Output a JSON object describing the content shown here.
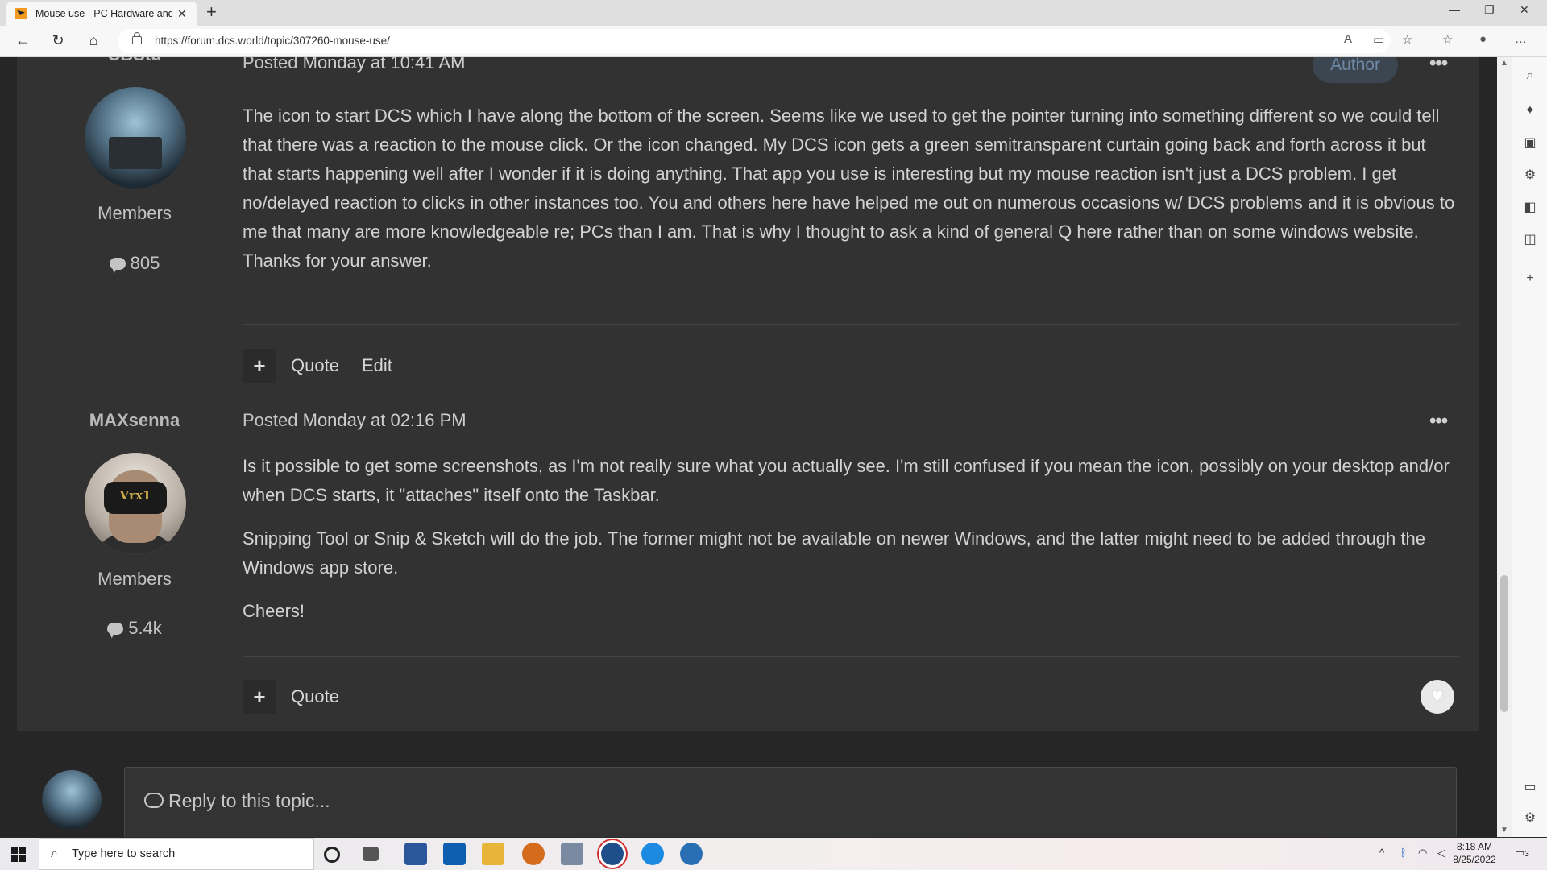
{
  "browser": {
    "tab_title": "Mouse use - PC Hardware and R",
    "tab_close": "✕",
    "new_tab": "+",
    "url": "https://forum.dcs.world/topic/307260-mouse-use/",
    "window_minimize": "—",
    "window_restore": "❐",
    "window_close": "✕"
  },
  "posts": [
    {
      "author": "CBStu",
      "posted_label": "Posted",
      "posted_time": "Monday at 10:41 AM",
      "badge": "Author",
      "group": "Members",
      "count": "805",
      "paragraphs": [
        "The icon to start DCS which I have along the bottom of the screen. Seems like we used to get the pointer turning into something different so we could tell that there was a reaction to the mouse click. Or the icon changed. My DCS icon gets a green semitransparent curtain going back and forth across it but that starts happening well after I wonder if it is doing anything. That app you use is interesting but my mouse reaction isn't just a DCS problem. I get no/delayed reaction to clicks in other instances too. You and others here have helped me out on numerous occasions w/ DCS problems and it is obvious to me that many are more knowledgeable re; PCs  than I am. That is why I thought to ask a kind of general Q here rather than on some windows website. Thanks for your answer."
      ],
      "actions": [
        "Quote",
        "Edit"
      ]
    },
    {
      "author": "MAXsenna",
      "posted_label": "Posted",
      "posted_time": "Monday at 02:16 PM",
      "group": "Members",
      "count": "5.4k",
      "avatar_text": "Vrx1",
      "paragraphs": [
        "Is it possible to get some screenshots, as I'm not really sure what you actually see. I'm still confused if you mean the icon, possibly on your desktop and/or when DCS starts, it \"attaches\" itself onto the Taskbar.",
        "Snipping Tool or Snip & Sketch will do the job. The former might not be available on newer Windows, and the latter might need to be added through the Windows app store.",
        "Cheers!"
      ],
      "actions": [
        "Quote"
      ]
    }
  ],
  "menu_dots": "•••",
  "plus_label": "+",
  "reply": {
    "placeholder": "Reply to this topic..."
  },
  "taskbar": {
    "search_placeholder": "Type here to search",
    "time": "8:18 AM",
    "date": "8/25/2022",
    "notifications": "3"
  },
  "colors": {
    "page_bg": "#262626",
    "post_bg": "#323232",
    "author_badge_text": "#6f8aa8"
  }
}
